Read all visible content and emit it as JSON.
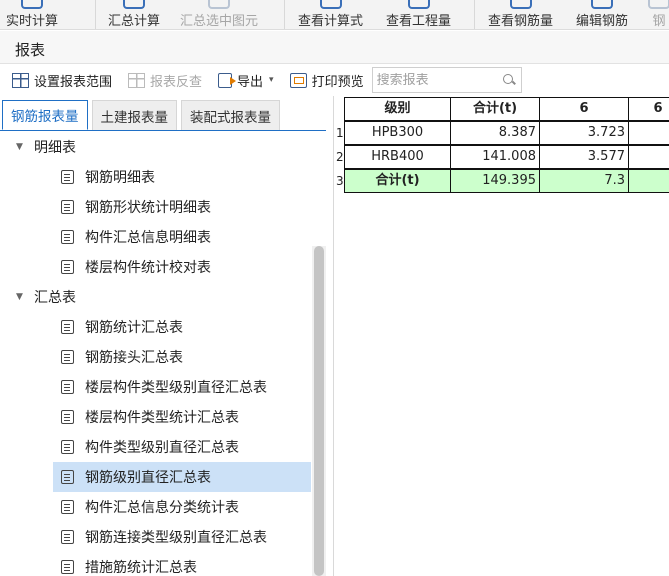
{
  "ribbon": {
    "items": [
      {
        "label": "实时计算",
        "dim": false
      },
      {
        "label": "汇总计算",
        "dim": false
      },
      {
        "label": "汇总选中图元",
        "dim": true
      },
      {
        "label": "查看计算式",
        "dim": false
      },
      {
        "label": "查看工程量",
        "dim": false
      },
      {
        "label": "查看钢筋量",
        "dim": false
      },
      {
        "label": "编辑钢筋",
        "dim": false
      },
      {
        "label": "钢",
        "dim": true
      }
    ]
  },
  "window": {
    "title": "报表"
  },
  "toolbar": {
    "set_range": "设置报表范围",
    "report_check": "报表反查",
    "export": "导出",
    "export_caret": "▾",
    "print_preview": "打印预览",
    "search_placeholder": "搜索报表"
  },
  "tabs": [
    {
      "label": "钢筋报表量",
      "active": true
    },
    {
      "label": "土建报表量",
      "active": false
    },
    {
      "label": "装配式报表量",
      "active": false
    }
  ],
  "tree": {
    "groups": [
      {
        "label": "明细表",
        "expanded": true,
        "items": [
          "钢筋明细表",
          "钢筋形状统计明细表",
          "构件汇总信息明细表",
          "楼层构件统计校对表"
        ]
      },
      {
        "label": "汇总表",
        "expanded": true,
        "items": [
          "钢筋统计汇总表",
          "钢筋接头汇总表",
          "楼层构件类型级别直径汇总表",
          "楼层构件类型统计汇总表",
          "构件类型级别直径汇总表",
          "钢筋级别直径汇总表",
          "构件汇总信息分类统计表",
          "钢筋连接类型级别直径汇总表",
          "措施筋统计汇总表"
        ]
      }
    ],
    "selected": "钢筋级别直径汇总表"
  },
  "table": {
    "headers": [
      "级别",
      "合计(t)",
      "6",
      "6"
    ],
    "rows": [
      {
        "num": "1",
        "cells": [
          "HPB300",
          "8.387",
          "3.723",
          ""
        ]
      },
      {
        "num": "2",
        "cells": [
          "HRB400",
          "141.008",
          "3.577",
          ""
        ]
      },
      {
        "num": "3",
        "cells": [
          "合计(t)",
          "149.395",
          "7.3",
          ""
        ]
      }
    ],
    "total_row_color": "#ccffcc"
  }
}
